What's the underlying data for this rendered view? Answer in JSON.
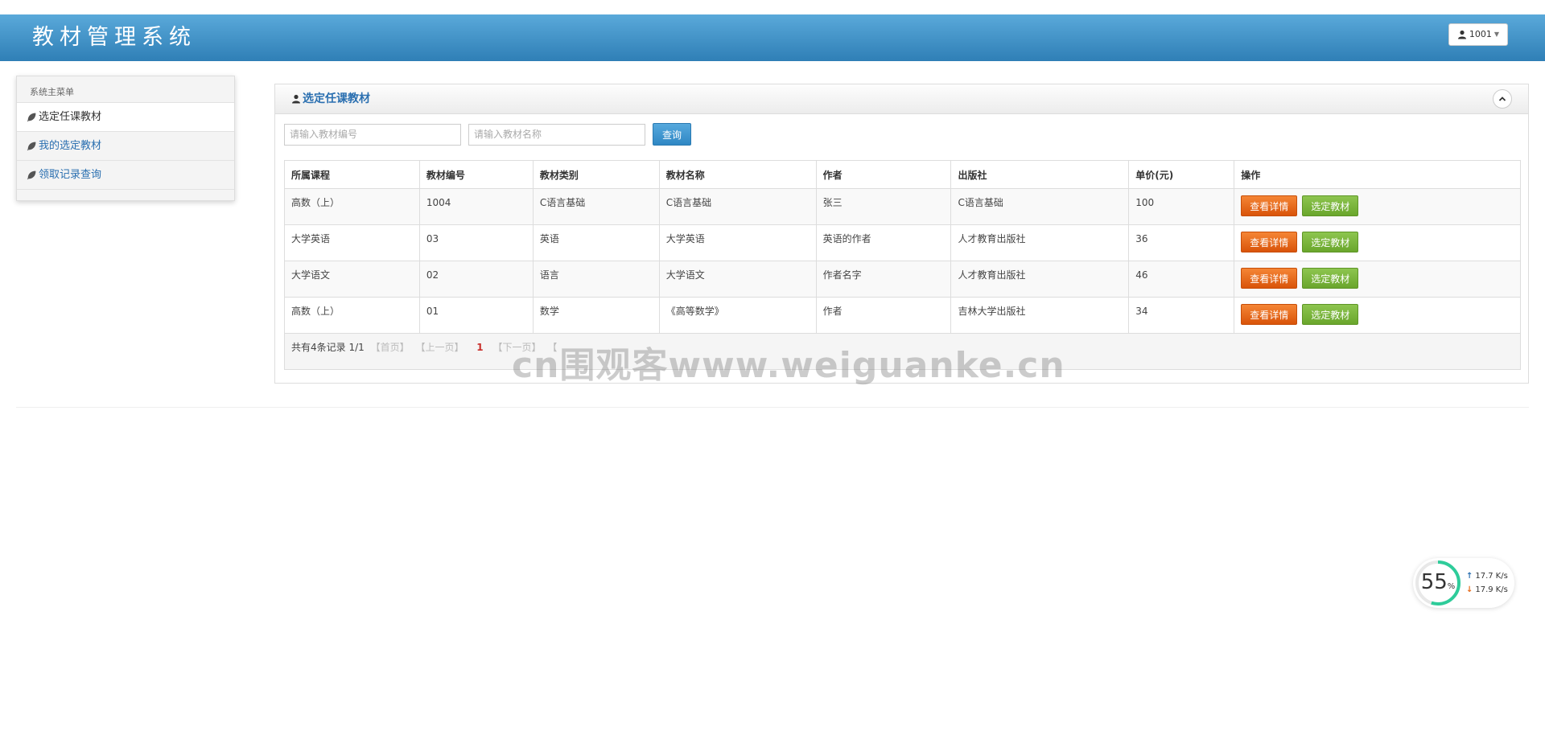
{
  "app": {
    "title": "教材管理系统"
  },
  "user_menu": {
    "label": "1001",
    "icon": "user-icon"
  },
  "sidebar": {
    "header": "系统主菜单",
    "items": [
      {
        "label": "选定任课教材",
        "icon": "leaf-icon",
        "active": true
      },
      {
        "label": "我的选定教材",
        "icon": "leaf-icon",
        "active": false
      },
      {
        "label": "领取记录查询",
        "icon": "leaf-icon",
        "active": false
      }
    ]
  },
  "panel": {
    "title": "选定任课教材",
    "title_icon": "user-icon",
    "collapse_icon": "chevron-up-icon"
  },
  "search": {
    "code_placeholder": "请输入教材编号",
    "name_placeholder": "请输入教材名称",
    "button_label": "查询"
  },
  "table": {
    "headers": [
      "所属课程",
      "教材编号",
      "教材类别",
      "教材名称",
      "作者",
      "出版社",
      "单价(元)",
      "操作"
    ],
    "rows": [
      {
        "course": "高数（上）",
        "code": "1004",
        "category": "C语言基础",
        "name": "C语言基础",
        "author": "张三",
        "publisher": "C语言基础",
        "price": "100",
        "detail_label": "查看详情",
        "select_label": "选定教材"
      },
      {
        "course": "大学英语",
        "code": "03",
        "category": "英语",
        "name": "大学英语",
        "author": "英语的作者",
        "publisher": "人才教育出版社",
        "price": "36",
        "detail_label": "查看详情",
        "select_label": "选定教材"
      },
      {
        "course": "大学语文",
        "code": "02",
        "category": "语言",
        "name": "大学语文",
        "author": "作者名字",
        "publisher": "人才教育出版社",
        "price": "46",
        "detail_label": "查看详情",
        "select_label": "选定教材"
      },
      {
        "course": "高数（上）",
        "code": "01",
        "category": "数学",
        "name": "《高等数学》",
        "author": "作者",
        "publisher": "吉林大学出版社",
        "price": "34",
        "detail_label": "查看详情",
        "select_label": "选定教材"
      }
    ]
  },
  "pager": {
    "summary": "共有4条记录  1/1",
    "first": "【首页】",
    "prev": "【上一页】",
    "current": "1",
    "next": "【下一页】",
    "last": "【"
  },
  "watermark": "cn围观客www.weiguanke.cn",
  "net_widget": {
    "percent": "55",
    "percent_unit": "%",
    "percent_value": 55,
    "upload": "17.7",
    "upload_unit": "K/s",
    "download": "17.9",
    "download_unit": "K/s",
    "ring_color": "#2ecc9a"
  }
}
